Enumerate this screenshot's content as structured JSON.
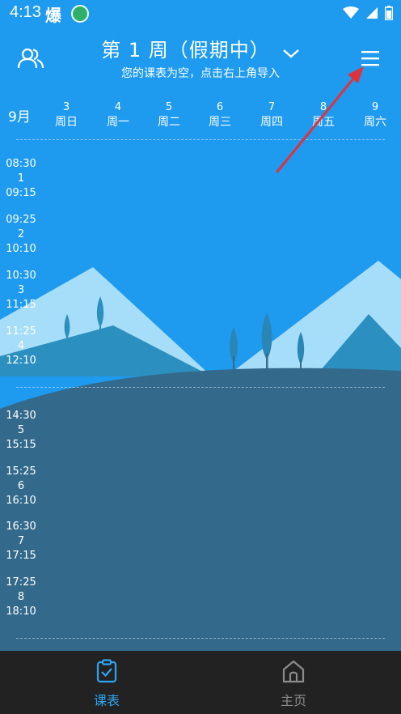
{
  "status": {
    "time": "4:13",
    "app_glyph": "爆"
  },
  "header": {
    "title": "第 1 周（假期中）",
    "subtitle": "您的课表为空，点击右上角导入"
  },
  "days": {
    "month": "9月",
    "list": [
      {
        "date": "3",
        "weekday": "周日"
      },
      {
        "date": "4",
        "weekday": "周一"
      },
      {
        "date": "5",
        "weekday": "周二"
      },
      {
        "date": "6",
        "weekday": "周三"
      },
      {
        "date": "7",
        "weekday": "周四"
      },
      {
        "date": "8",
        "weekday": "周五"
      },
      {
        "date": "9",
        "weekday": "周六"
      }
    ]
  },
  "slots": [
    {
      "start": "08:30",
      "num": "1",
      "end": "09:15"
    },
    {
      "start": "09:25",
      "num": "2",
      "end": "10:10"
    },
    {
      "start": "10:30",
      "num": "3",
      "end": "11:15"
    },
    {
      "start": "11:25",
      "num": "4",
      "end": "12:10"
    },
    {
      "start": "14:30",
      "num": "5",
      "end": "15:15"
    },
    {
      "start": "15:25",
      "num": "6",
      "end": "16:10"
    },
    {
      "start": "16:30",
      "num": "7",
      "end": "17:15"
    },
    {
      "start": "17:25",
      "num": "8",
      "end": "18:10"
    }
  ],
  "nav": {
    "schedule_label": "课表",
    "home_label": "主页"
  },
  "colors": {
    "sky": "#1E9AEF",
    "mountain_light": "#A6DDF8",
    "mountain_mid": "#2B8FC0",
    "hill": "#336A8B",
    "accent": "#2FA5F2",
    "arrow": "#E0323C"
  }
}
